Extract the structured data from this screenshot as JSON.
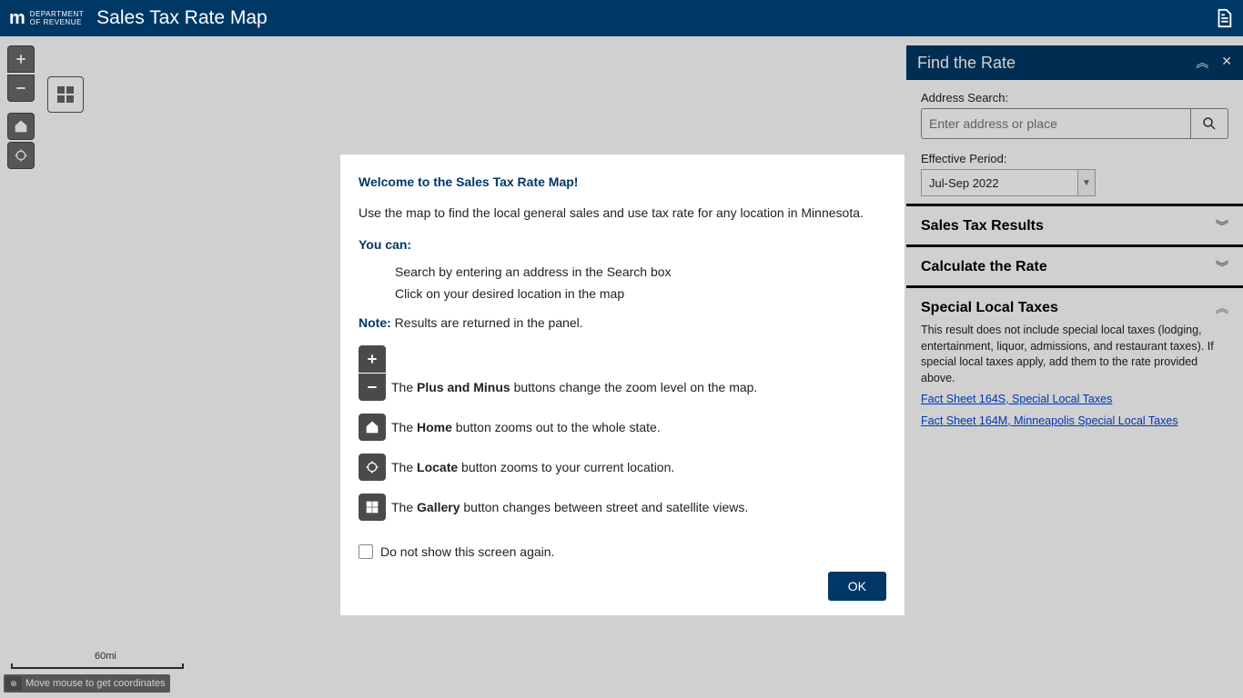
{
  "header": {
    "dept_top": "DEPARTMENT",
    "dept_bot": "OF REVENUE",
    "app_title": "Sales Tax Rate Map"
  },
  "map": {
    "scale_label": "60mi",
    "coord_hint": "Move mouse to get coordinates"
  },
  "sidebar": {
    "title": "Find the Rate",
    "address_label": "Address Search:",
    "address_placeholder": "Enter address or place",
    "period_label": "Effective Period:",
    "period_value": "Jul-Sep 2022",
    "sections": {
      "results": "Sales Tax Results",
      "calc": "Calculate the Rate",
      "special": "Special Local Taxes"
    },
    "special_body": "This result does not include special local taxes (lodging, entertainment, liquor, admissions, and restaurant taxes). If special local taxes apply, add them to the rate provided above.",
    "link1": "Fact Sheet 164S, Special Local Taxes",
    "link2": "Fact Sheet 164M, Minneapolis Special Local Taxes"
  },
  "modal": {
    "welcome": "Welcome to the Sales Tax Rate Map!",
    "intro": "Use the map to find the local general sales and use tax rate for any location in Minnesota.",
    "youcan": "You can:",
    "li1": "Search by entering an address in the Search box",
    "li2": "Click on your desired location in the map",
    "note_label": "Note:",
    "note_text": " Results are returned in the panel.",
    "zoom_pre": "The ",
    "zoom_b": "Plus and Minus",
    "zoom_post": " buttons change the zoom level on the map.",
    "home_pre": "The ",
    "home_b": "Home",
    "home_post": " button zooms out to the whole state.",
    "locate_pre": "The ",
    "locate_b": "Locate",
    "locate_post": " button zooms to your current location.",
    "gallery_pre": "The ",
    "gallery_b": "Gallery",
    "gallery_post": " button changes between street and satellite views.",
    "checkbox": "Do not show this screen again.",
    "ok": "OK"
  }
}
